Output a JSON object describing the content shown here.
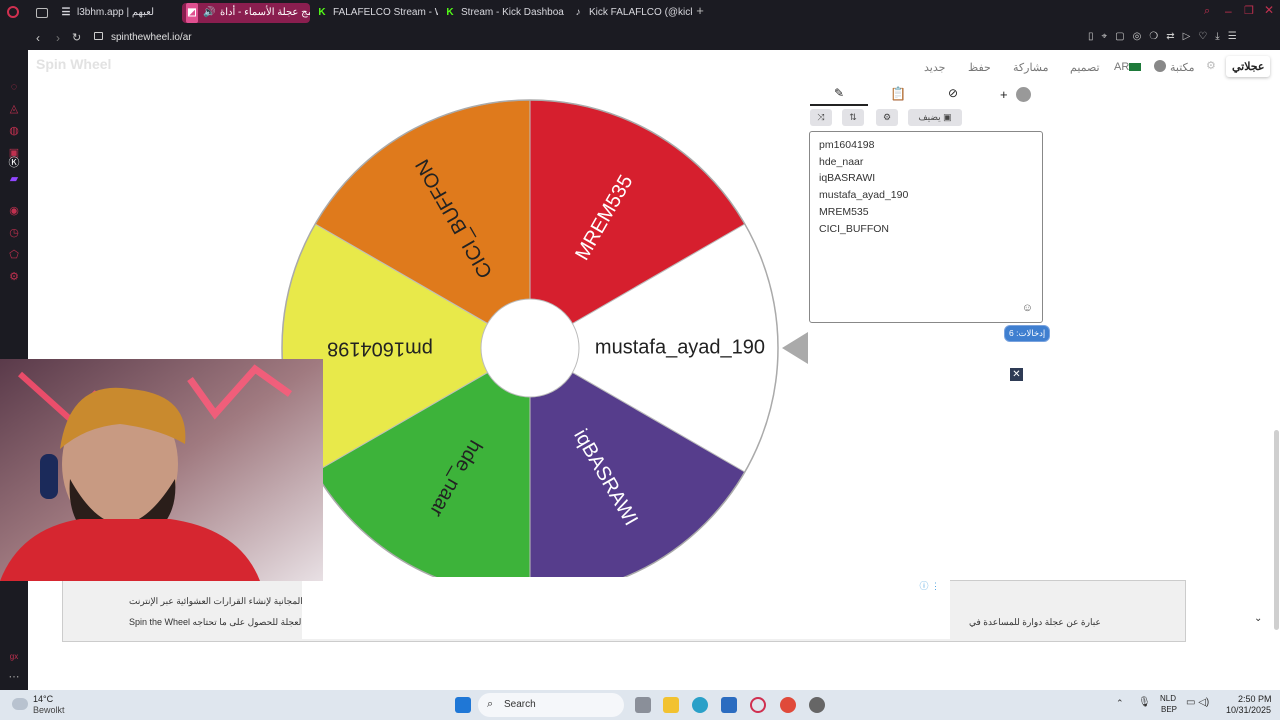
{
  "browser": {
    "tabs": [
      {
        "label": "l3bhm.app | لعبهم",
        "active": false
      },
      {
        "label": "برنامج عجلة الأسماء - أداة",
        "active": true
      },
      {
        "label": "FALAFELCO Stream - Wa",
        "active": false
      },
      {
        "label": "Stream - Kick Dashboard",
        "active": false
      },
      {
        "label": "Kick FALAFLCO (@kick_fa",
        "active": false
      }
    ],
    "url": "spinthewheel.io/ar"
  },
  "site": {
    "logo": "Spin Wheel",
    "nav": {
      "language": "AR",
      "my_wheels": "عجلاتي",
      "library": "مكتبة",
      "design": "تصميم",
      "share": "مشاركة",
      "save": "حفظ",
      "new": "جديد"
    }
  },
  "wheel": {
    "pointer_label": "mustafa_ayad_190",
    "segments": [
      {
        "label": "mustafa_ayad_190",
        "color": "#ffffff",
        "text_color": "#222222"
      },
      {
        "label": "iqBASRAWI",
        "color": "#563d8c",
        "text_color": "#ffffff"
      },
      {
        "label": "hde_naar",
        "color": "#3db33a",
        "text_color": "#222222"
      },
      {
        "label": "pm1604198",
        "color": "#e8e94a",
        "text_color": "#222222"
      },
      {
        "label": "CICI_BUFFON",
        "color": "#df7a1c",
        "text_color": "#222222"
      },
      {
        "label": "MREM535",
        "color": "#d61f2e",
        "text_color": "#ffffff"
      }
    ]
  },
  "panel": {
    "add_image_label": "يضيف",
    "entries": [
      "pm1604198",
      "hde_naar",
      "iqBASRAWI",
      "mustafa_ayad_190",
      "MREM535",
      "CICI_BUFFON"
    ],
    "entries_count_label": "إدخالات: 6"
  },
  "footer": {
    "line1": "ه الأداة المجانية لإنشاء القرارات العشوائية عبر الإنترنت",
    "line2": "Spin the Wheel تدوير العجلة للحصول على ما تحتاجه",
    "line3": "عبارة عن عجلة دوارة للمساعدة في"
  },
  "taskbar": {
    "temperature": "14°C",
    "weather": "Bewolkt",
    "search": "Search",
    "lang_top": "NLD",
    "lang_bottom": "BEP",
    "time": "2:50 PM",
    "date": "10/31/2025"
  },
  "colors": {
    "browser_bg": "#1b1b22",
    "active_tab": "#8a1e4f",
    "opera_red": "#c0304f"
  }
}
